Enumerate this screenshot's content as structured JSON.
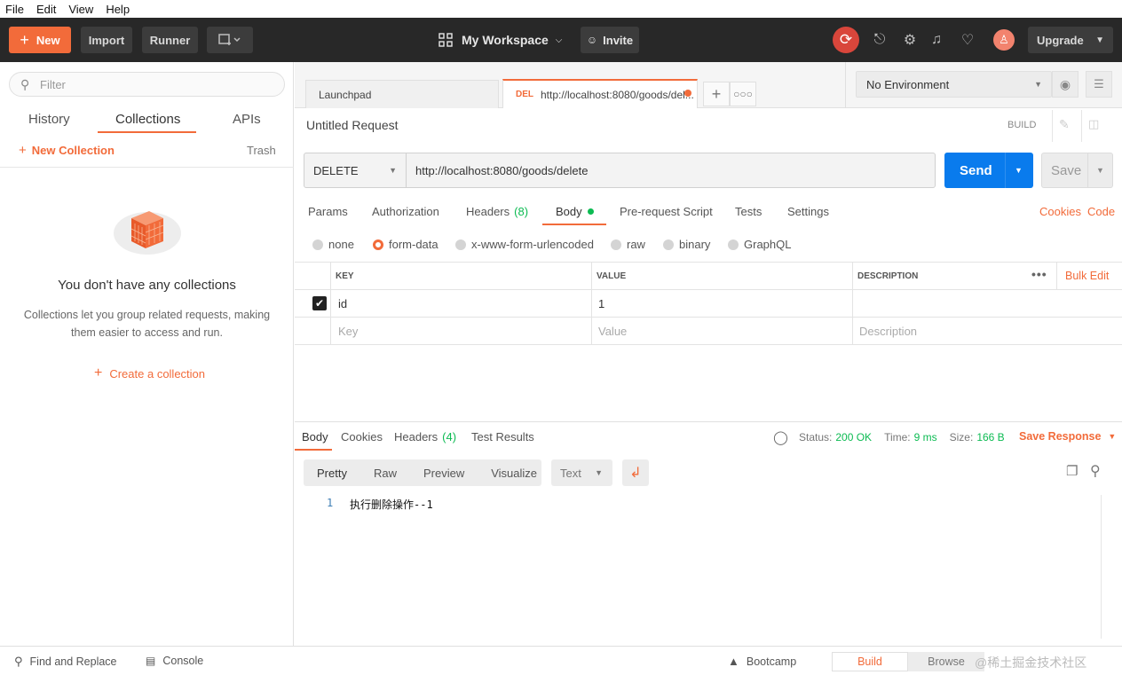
{
  "menu": [
    "File",
    "Edit",
    "View",
    "Help"
  ],
  "toolbar": {
    "new_label": "New",
    "import_label": "Import",
    "runner_label": "Runner",
    "workspace_label": "My Workspace",
    "invite_label": "Invite",
    "upgrade_label": "Upgrade"
  },
  "sidebar": {
    "filter_placeholder": "Filter",
    "tabs": [
      "History",
      "Collections",
      "APIs"
    ],
    "new_collection_label": "New Collection",
    "trash_label": "Trash",
    "empty_title": "You don't have any collections",
    "empty_desc_line1": "Collections let you group related requests, making",
    "empty_desc_line2": "them easier to access and run.",
    "create_label": "Create a collection"
  },
  "tabs": {
    "launchpad_label": "Launchpad",
    "active_method": "DEL",
    "active_url": "http://localhost:8080/goods/del..."
  },
  "environment": {
    "selected": "No Environment"
  },
  "request": {
    "title": "Untitled Request",
    "build_label": "BUILD",
    "method": "DELETE",
    "url": "http://localhost:8080/goods/delete",
    "send_label": "Send",
    "save_label": "Save",
    "subtabs": {
      "params": "Params",
      "authorization": "Authorization",
      "headers": "Headers",
      "headers_count": "(8)",
      "body": "Body",
      "prerequest": "Pre-request Script",
      "tests": "Tests",
      "settings": "Settings"
    },
    "cookies_label": "Cookies",
    "code_label": "Code",
    "body_types": [
      "none",
      "form-data",
      "x-www-form-urlencoded",
      "raw",
      "binary",
      "GraphQL"
    ],
    "body_selected": "form-data",
    "table_headers": {
      "key": "KEY",
      "value": "VALUE",
      "description": "DESCRIPTION",
      "bulk_edit": "Bulk Edit"
    },
    "rows": [
      {
        "key": "id",
        "value": "1",
        "checked": true
      }
    ],
    "placeholders": {
      "key": "Key",
      "value": "Value",
      "description": "Description"
    }
  },
  "response": {
    "tabs": {
      "body": "Body",
      "cookies": "Cookies",
      "headers": "Headers",
      "headers_count": "(4)",
      "tests": "Test Results"
    },
    "status_label": "Status:",
    "status_value": "200 OK",
    "time_label": "Time:",
    "time_value": "9 ms",
    "size_label": "Size:",
    "size_value": "166 B",
    "save_label": "Save Response",
    "views": [
      "Pretty",
      "Raw",
      "Preview",
      "Visualize"
    ],
    "format": "Text",
    "line_number": "1",
    "line_text": "执行删除操作--1"
  },
  "footer": {
    "find_label": "Find and Replace",
    "console_label": "Console",
    "bootcamp_label": "Bootcamp",
    "build_label": "Build",
    "browse_label": "Browse",
    "watermark": "@稀土掘金技术社区"
  },
  "colors": {
    "accent": "#f26b3a",
    "send_blue": "#097bed",
    "status_green": "#0cbb52"
  }
}
